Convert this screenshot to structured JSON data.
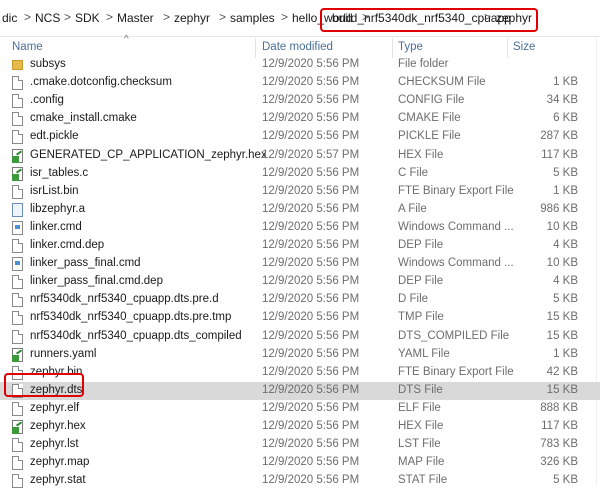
{
  "breadcrumb": {
    "items": [
      "dic",
      "NCS",
      "SDK",
      "Master",
      "zephyr",
      "samples",
      "hello_world",
      "build_nrf5340dk_nrf5340_cpuapp",
      "zephyr"
    ],
    "separator": ">"
  },
  "columns": {
    "name": "Name",
    "date": "Date modified",
    "type": "Type",
    "size": "Size"
  },
  "rows": [
    {
      "name": "subsys",
      "date": "12/9/2020 5:56 PM",
      "type": "File folder",
      "size": "",
      "icon": "folder-icon"
    },
    {
      "name": ".cmake.dotconfig.checksum",
      "date": "12/9/2020 5:56 PM",
      "type": "CHECKSUM File",
      "size": "1 KB",
      "icon": "file-icon"
    },
    {
      "name": ".config",
      "date": "12/9/2020 5:56 PM",
      "type": "CONFIG File",
      "size": "34 KB",
      "icon": "file-icon"
    },
    {
      "name": "cmake_install.cmake",
      "date": "12/9/2020 5:56 PM",
      "type": "CMAKE File",
      "size": "6 KB",
      "icon": "file-icon"
    },
    {
      "name": "edt.pickle",
      "date": "12/9/2020 5:56 PM",
      "type": "PICKLE File",
      "size": "287 KB",
      "icon": "file-icon"
    },
    {
      "name": "GENERATED_CP_APPLICATION_zephyr.hex",
      "date": "12/9/2020 5:57 PM",
      "type": "HEX File",
      "size": "117 KB",
      "icon": "editable-file-icon"
    },
    {
      "name": "isr_tables.c",
      "date": "12/9/2020 5:56 PM",
      "type": "C File",
      "size": "5 KB",
      "icon": "editable-file-icon"
    },
    {
      "name": "isrList.bin",
      "date": "12/9/2020 5:56 PM",
      "type": "FTE Binary Export File",
      "size": "1 KB",
      "icon": "file-icon"
    },
    {
      "name": "libzephyr.a",
      "date": "12/9/2020 5:56 PM",
      "type": "A File",
      "size": "986 KB",
      "icon": "archive-file-icon"
    },
    {
      "name": "linker.cmd",
      "date": "12/9/2020 5:56 PM",
      "type": "Windows Command ...",
      "size": "10 KB",
      "icon": "command-file-icon"
    },
    {
      "name": "linker.cmd.dep",
      "date": "12/9/2020 5:56 PM",
      "type": "DEP File",
      "size": "4 KB",
      "icon": "file-icon"
    },
    {
      "name": "linker_pass_final.cmd",
      "date": "12/9/2020 5:56 PM",
      "type": "Windows Command ...",
      "size": "10 KB",
      "icon": "command-file-icon"
    },
    {
      "name": "linker_pass_final.cmd.dep",
      "date": "12/9/2020 5:56 PM",
      "type": "DEP File",
      "size": "4 KB",
      "icon": "file-icon"
    },
    {
      "name": "nrf5340dk_nrf5340_cpuapp.dts.pre.d",
      "date": "12/9/2020 5:56 PM",
      "type": "D File",
      "size": "5 KB",
      "icon": "file-icon"
    },
    {
      "name": "nrf5340dk_nrf5340_cpuapp.dts.pre.tmp",
      "date": "12/9/2020 5:56 PM",
      "type": "TMP File",
      "size": "15 KB",
      "icon": "file-icon"
    },
    {
      "name": "nrf5340dk_nrf5340_cpuapp.dts_compiled",
      "date": "12/9/2020 5:56 PM",
      "type": "DTS_COMPILED File",
      "size": "15 KB",
      "icon": "file-icon"
    },
    {
      "name": "runners.yaml",
      "date": "12/9/2020 5:56 PM",
      "type": "YAML File",
      "size": "1 KB",
      "icon": "editable-file-icon"
    },
    {
      "name": "zephyr.bin",
      "date": "12/9/2020 5:56 PM",
      "type": "FTE Binary Export File",
      "size": "42 KB",
      "icon": "file-icon"
    },
    {
      "name": "zephyr.dts",
      "date": "12/9/2020 5:56 PM",
      "type": "DTS File",
      "size": "15 KB",
      "icon": "file-icon",
      "selected": true
    },
    {
      "name": "zephyr.elf",
      "date": "12/9/2020 5:56 PM",
      "type": "ELF File",
      "size": "888 KB",
      "icon": "file-icon"
    },
    {
      "name": "zephyr.hex",
      "date": "12/9/2020 5:56 PM",
      "type": "HEX File",
      "size": "117 KB",
      "icon": "editable-file-icon"
    },
    {
      "name": "zephyr.lst",
      "date": "12/9/2020 5:56 PM",
      "type": "LST File",
      "size": "783 KB",
      "icon": "file-icon"
    },
    {
      "name": "zephyr.map",
      "date": "12/9/2020 5:56 PM",
      "type": "MAP File",
      "size": "326 KB",
      "icon": "file-icon"
    },
    {
      "name": "zephyr.stat",
      "date": "12/9/2020 5:56 PM",
      "type": "STAT File",
      "size": "5 KB",
      "icon": "file-icon"
    }
  ],
  "colors": {
    "highlight": "#e00000",
    "selected_row": "#d9d9d9",
    "header_text": "#4a6f99"
  }
}
